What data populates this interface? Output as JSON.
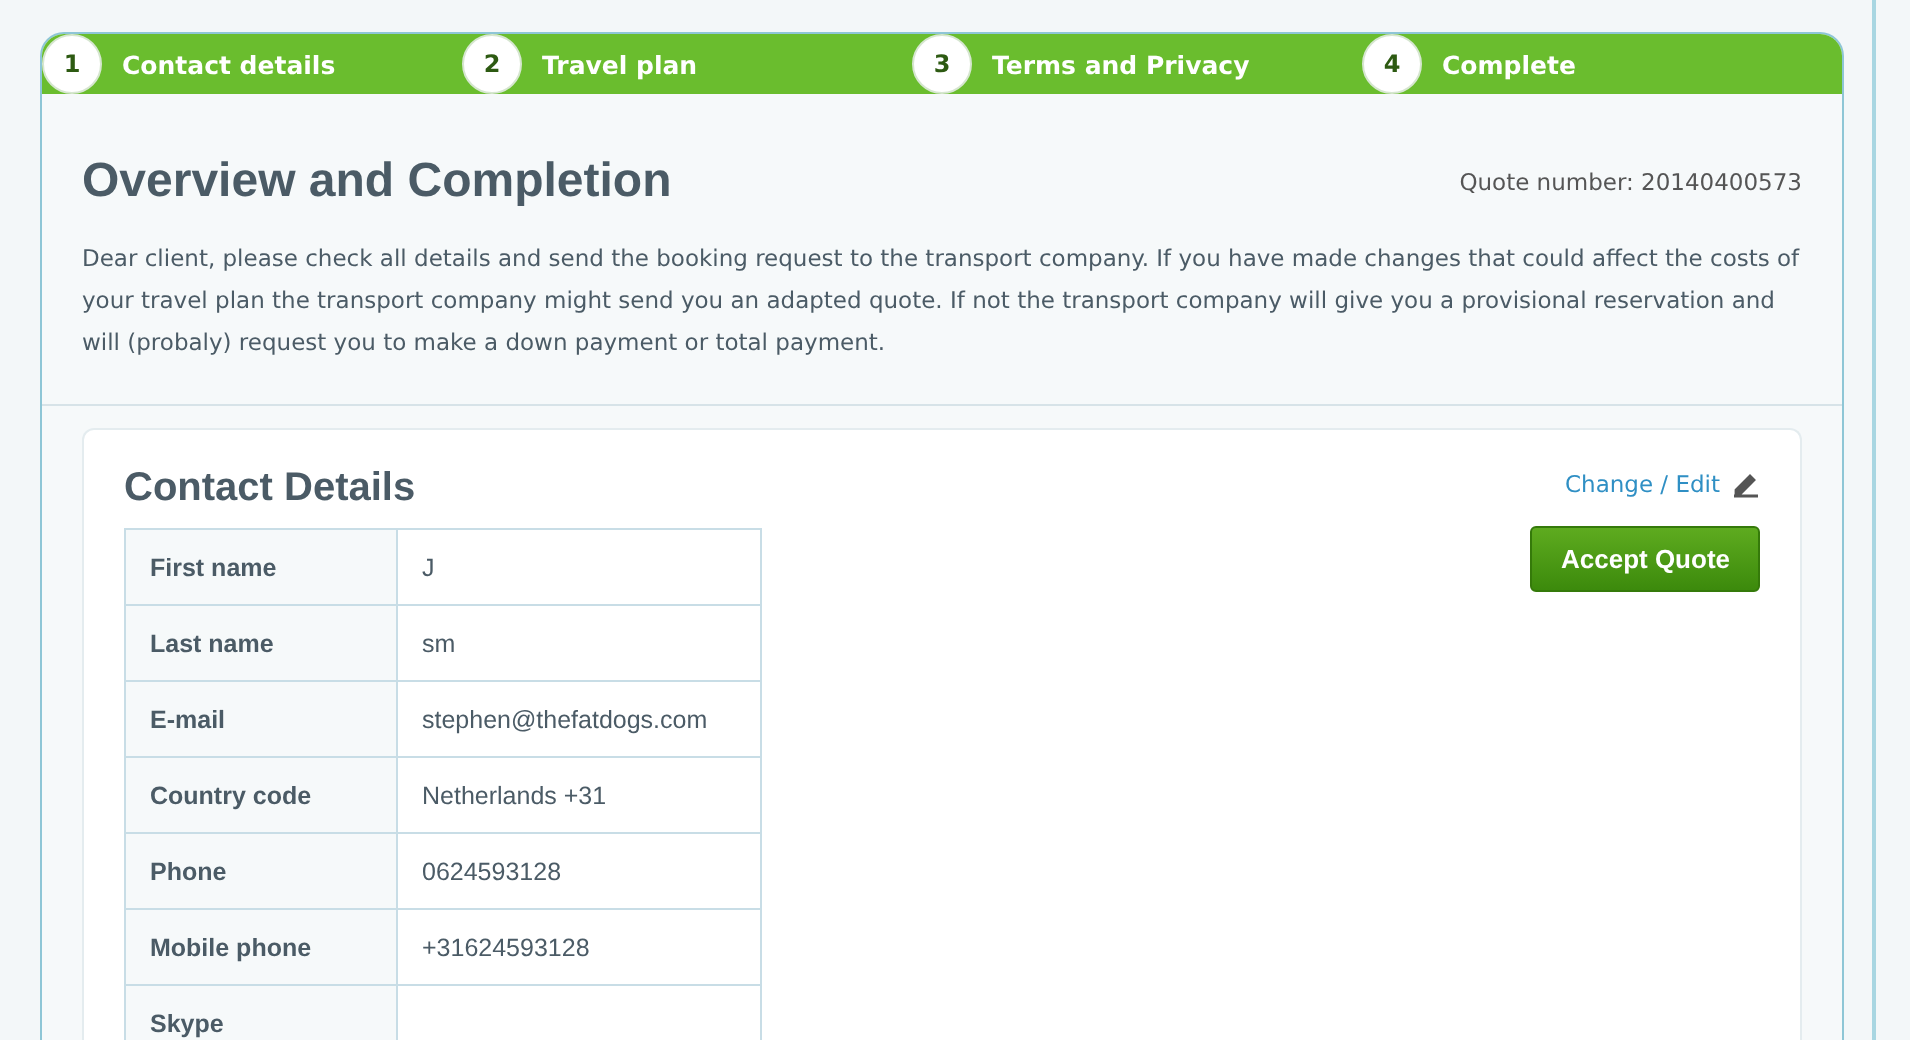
{
  "steps": [
    {
      "number": "1",
      "label": "Contact details"
    },
    {
      "number": "2",
      "label": "Travel plan"
    },
    {
      "number": "3",
      "label": "Terms and Privacy"
    },
    {
      "number": "4",
      "label": "Complete"
    }
  ],
  "header": {
    "title": "Overview and Completion",
    "quote_number": "Quote number: 20140400573",
    "intro": "Dear client, please check all details and send the booking request to the transport company. If you have made changes that could affect the costs of your travel plan the transport company might send you an adapted quote. If not the transport company will give you a provisional reservation and will (probaly) request you to make a down payment or total payment."
  },
  "contact": {
    "title": "Contact Details",
    "edit_link": "Change / Edit",
    "accept_button": "Accept Quote",
    "rows": [
      {
        "label": "First name",
        "value": "J"
      },
      {
        "label": "Last name",
        "value": "sm"
      },
      {
        "label": "E-mail",
        "value": "stephen@thefatdogs.com"
      },
      {
        "label": "Country code",
        "value": "Netherlands +31"
      },
      {
        "label": "Phone",
        "value": "0624593128"
      },
      {
        "label": "Mobile phone",
        "value": "+31624593128"
      },
      {
        "label": "Skype",
        "value": ""
      }
    ]
  }
}
